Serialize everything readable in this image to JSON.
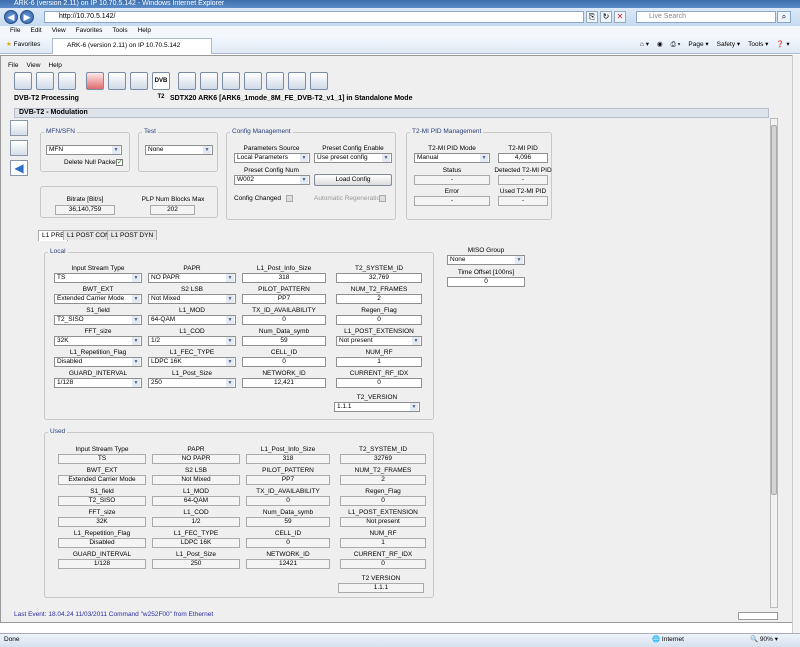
{
  "browser": {
    "title": "ARK-6 (version 2.11) on IP 10.70.5.142 - Windows Internet Explorer",
    "url": "http://10.70.5.142/",
    "search_placeholder": "Live Search",
    "menu": [
      "File",
      "Edit",
      "View",
      "Favorites",
      "Tools",
      "Help"
    ],
    "favorites_label": "Favorites",
    "tab_title": "ARK-6 (version 2.11) on IP 10.70.5.142",
    "commands": [
      "Page ▾",
      "Safety ▾",
      "Tools ▾",
      "❓ ▾"
    ],
    "status": "Done",
    "zone": "Internet",
    "zoom": "90%"
  },
  "app": {
    "menu": [
      "File",
      "View",
      "Help"
    ],
    "title": "DVB-T2 Processing",
    "subtitle": "SDTX20 ARK6 [ARK6_1mode_8M_FE_DVB-T2_v1_1] in Standalone Mode",
    "module": "DVB-T2 - Modulation",
    "toolbar_badge": "DVB T2",
    "status_line": "Last Event: 18.04.24 11/03/2011 Command \"w252F00\" from Ethernet"
  },
  "mfn": {
    "title": "MFN/SFN",
    "mode": "MFN",
    "delete_null": "Delete Null Packets"
  },
  "test": {
    "title": "Test",
    "value": "None"
  },
  "config": {
    "title": "Config Management",
    "params_source_label": "Parameters Source",
    "params_source": "Local Parameters",
    "preset_enable_label": "Preset Config Enable",
    "preset_enable": "Use preset config",
    "preset_num_label": "Preset Config Num",
    "preset_num": "W002",
    "load": "Load Config",
    "changed": "Config Changed",
    "auto_regen": "Automatic Regeneration"
  },
  "t2mi": {
    "title": "T2-MI PID Management",
    "mode_label": "T2-MI PID Mode",
    "mode": "Manual",
    "pid_label": "T2-MI PID",
    "pid": "4,096",
    "status_label": "Status",
    "status": "-",
    "detected_label": "Detected T2-MI PID",
    "detected": "-",
    "error_label": "Error",
    "error": "-",
    "used_label": "Used T2-MI PID",
    "used": "-"
  },
  "bitrate": {
    "label": "Bitrate [Bit/s]",
    "value": "36,140,759",
    "plp_label": "PLP Num Blocks Max",
    "plp": "202"
  },
  "tabs": [
    "L1 PRE",
    "L1 POST CONF",
    "L1 POST DYN"
  ],
  "miso": {
    "label": "MISO Group",
    "value": "None",
    "offset_label": "Time Offset [100ns]",
    "offset": "0"
  },
  "local": {
    "title": "Local",
    "rows": [
      [
        {
          "label": "Input Stream Type",
          "value": "TS"
        },
        {
          "label": "PAPR",
          "value": "NO PAPR"
        },
        {
          "label": "L1_Post_Info_Size",
          "value": "318"
        },
        {
          "label": "T2_SYSTEM_ID",
          "value": "32,769"
        }
      ],
      [
        {
          "label": "BWT_EXT",
          "value": "Extended Carrier Mode"
        },
        {
          "label": "S2 LSB",
          "value": "Not Mixed"
        },
        {
          "label": "PILOT_PATTERN",
          "value": "PP7"
        },
        {
          "label": "NUM_T2_FRAMES",
          "value": "2"
        }
      ],
      [
        {
          "label": "S1_field",
          "value": "T2_SISO"
        },
        {
          "label": "L1_MOD",
          "value": "64-QAM"
        },
        {
          "label": "TX_ID_AVAILABILITY",
          "value": "0"
        },
        {
          "label": "Regen_Flag",
          "value": "0"
        }
      ],
      [
        {
          "label": "FFT_size",
          "value": "32K"
        },
        {
          "label": "L1_COD",
          "value": "1/2"
        },
        {
          "label": "Num_Data_symb",
          "value": "59"
        },
        {
          "label": "L1_POST_EXTENSION",
          "value": "Not present"
        }
      ],
      [
        {
          "label": "L1_Repetition_Flag",
          "value": "Disabled"
        },
        {
          "label": "L1_FEC_TYPE",
          "value": "LDPC 16K"
        },
        {
          "label": "CELL_ID",
          "value": "0"
        },
        {
          "label": "NUM_RF",
          "value": "1"
        }
      ],
      [
        {
          "label": "GUARD_INTERVAL",
          "value": "1/128"
        },
        {
          "label": "L1_Post_Size",
          "value": "250"
        },
        {
          "label": "NETWORK_ID",
          "value": "12,421"
        },
        {
          "label": "CURRENT_RF_IDX",
          "value": "0"
        }
      ]
    ],
    "t2_version_label": "T2_VERSION",
    "t2_version": "1.1.1"
  },
  "used": {
    "title": "Used",
    "rows": [
      [
        {
          "label": "Input Stream Type",
          "value": "TS"
        },
        {
          "label": "PAPR",
          "value": "NO PAPR"
        },
        {
          "label": "L1_Post_Info_Size",
          "value": "318"
        },
        {
          "label": "T2_SYSTEM_ID",
          "value": "32769"
        }
      ],
      [
        {
          "label": "BWT_EXT",
          "value": "Extended Carrier Mode"
        },
        {
          "label": "S2 LSB",
          "value": "Not Mixed"
        },
        {
          "label": "PILOT_PATTERN",
          "value": "PP7"
        },
        {
          "label": "NUM_T2_FRAMES",
          "value": "2"
        }
      ],
      [
        {
          "label": "S1_field",
          "value": "T2_SISO"
        },
        {
          "label": "L1_MOD",
          "value": "64-QAM"
        },
        {
          "label": "TX_ID_AVAILABILITY",
          "value": "0"
        },
        {
          "label": "Regen_Flag",
          "value": "0"
        }
      ],
      [
        {
          "label": "FFT_size",
          "value": "32K"
        },
        {
          "label": "L1_COD",
          "value": "1/2"
        },
        {
          "label": "Num_Data_symb",
          "value": "59"
        },
        {
          "label": "L1_POST_EXTENSION",
          "value": "Not present"
        }
      ],
      [
        {
          "label": "L1_Repetition_Flag",
          "value": "Disabled"
        },
        {
          "label": "L1_FEC_TYPE",
          "value": "LDPC 16K"
        },
        {
          "label": "CELL_ID",
          "value": "0"
        },
        {
          "label": "NUM_RF",
          "value": "1"
        }
      ],
      [
        {
          "label": "GUARD_INTERVAL",
          "value": "1/128"
        },
        {
          "label": "L1_Post_Size",
          "value": "250"
        },
        {
          "label": "NETWORK_ID",
          "value": "12421"
        },
        {
          "label": "CURRENT_RF_IDX",
          "value": "0"
        }
      ]
    ],
    "t2_version_label": "T2 VERSION",
    "t2_version": "1.1.1"
  }
}
